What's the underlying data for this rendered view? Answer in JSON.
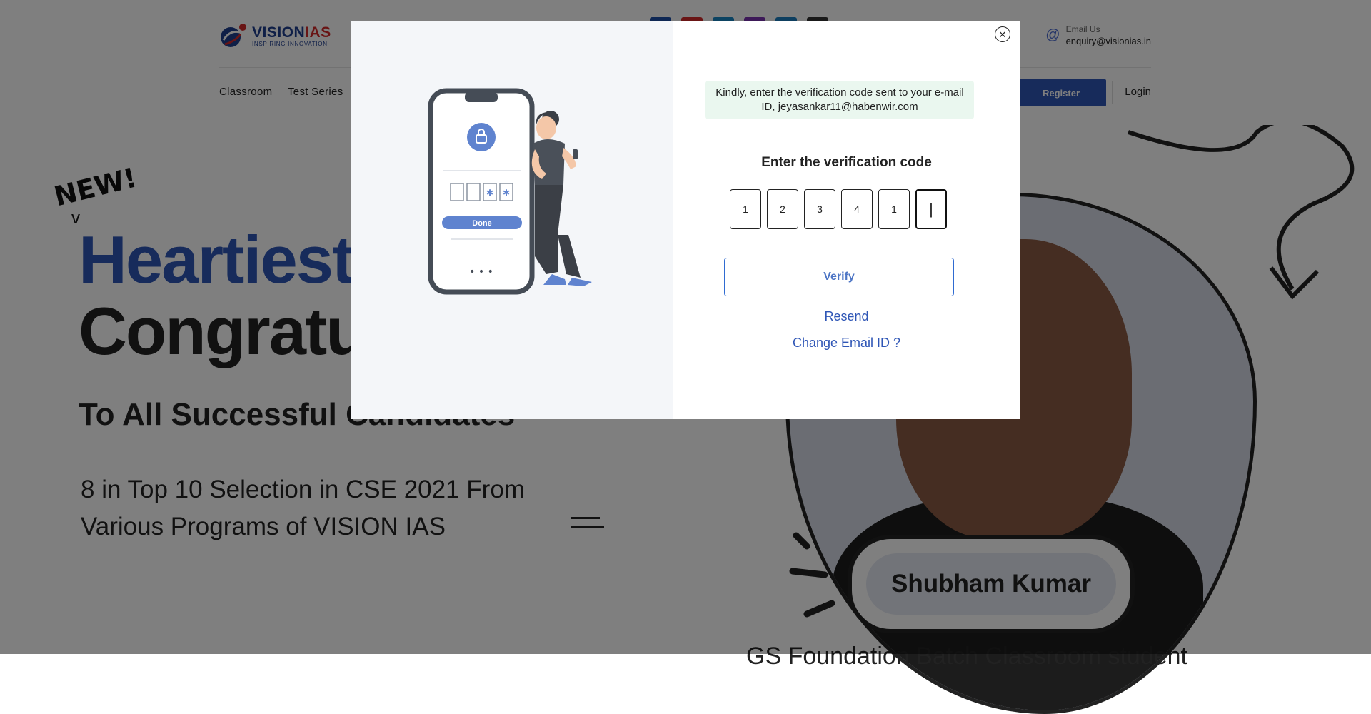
{
  "header": {
    "logo": {
      "brand_part1": "VISION",
      "brand_part2": "IAS",
      "tagline": "INSPIRING INNOVATION"
    },
    "email": {
      "label": "Email Us",
      "value": "enquiry@visionias.in",
      "icon": "at-icon"
    },
    "social_colors": [
      "#1d4fa8",
      "#d42b2b",
      "#1886c4",
      "#7b32b0",
      "#1c7fc0",
      "#333333"
    ]
  },
  "nav": {
    "items": [
      "Classroom",
      "Test Series"
    ],
    "register_label": "Register",
    "login_label": "Login"
  },
  "hero": {
    "badge": "NEW!",
    "headline_1": "Heartiest",
    "headline_2": "Congratu",
    "subheadline": "To All Successful Candidates",
    "description": "8 in Top 10 Selection in CSE 2021 From Various Programs of VISION IAS",
    "student_name": "Shubham Kumar",
    "caption": "GS Foundation Batch Classroom student"
  },
  "modal": {
    "info_text": "Kindly, enter the verification code sent to your e-mail ID, jeyasankar11@habenwir.com",
    "title": "Enter the verification code",
    "code_digits": [
      "1",
      "2",
      "3",
      "4",
      "1",
      "|"
    ],
    "verify_label": "Verify",
    "resend_label": "Resend",
    "change_email_label": "Change Email ID ?",
    "close_icon": "close-icon",
    "illustration": {
      "done_label": "Done",
      "dots": "• • •",
      "masked": "✱"
    }
  },
  "colors": {
    "accent": "#2f56b6",
    "overlay": "rgba(0,0,0,0.5)",
    "info_bg": "#eaf7ef",
    "illustration_bg": "#f4f6f9"
  }
}
